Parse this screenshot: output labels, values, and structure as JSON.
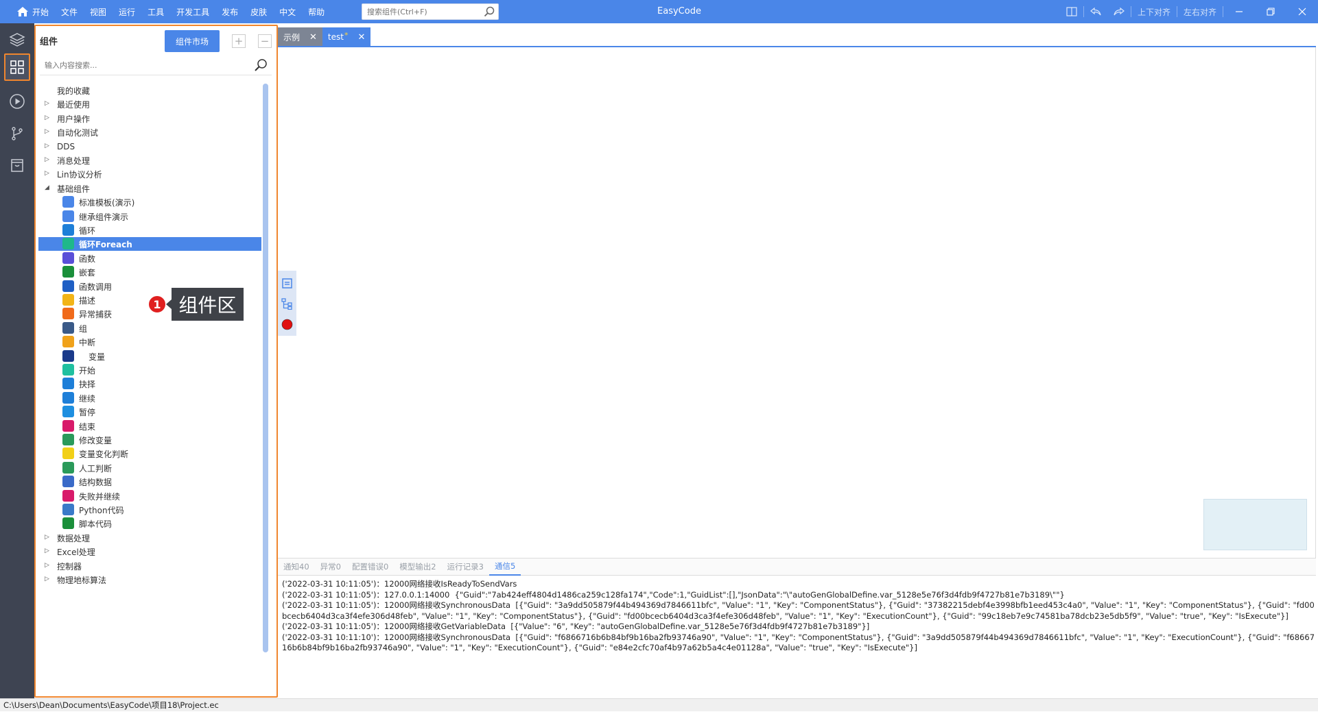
{
  "titlebar": {
    "app_title": "EasyCode",
    "menu": [
      "开始",
      "文件",
      "视图",
      "运行",
      "工具",
      "开发工具",
      "发布",
      "皮肤",
      "中文",
      "帮助"
    ],
    "search_placeholder": "搜索组件(Ctrl+F)",
    "align_vertical": "上下对齐",
    "align_horizontal": "左右对齐"
  },
  "panel": {
    "title": "组件",
    "market_button": "组件市场",
    "filter_placeholder": "输入内容搜索...",
    "tree": [
      {
        "label": "我的收藏",
        "level": 0,
        "caret": "none"
      },
      {
        "label": "最近使用",
        "level": 0,
        "caret": "collapsed"
      },
      {
        "label": "用户操作",
        "level": 0,
        "caret": "collapsed"
      },
      {
        "label": "自动化测试",
        "level": 0,
        "caret": "collapsed"
      },
      {
        "label": "DDS",
        "level": 0,
        "caret": "collapsed"
      },
      {
        "label": "消息处理",
        "level": 0,
        "caret": "collapsed"
      },
      {
        "label": "Lin协议分析",
        "level": 0,
        "caret": "collapsed"
      },
      {
        "label": "基础组件",
        "level": 0,
        "caret": "expanded"
      },
      {
        "label": "标准模板(演示)",
        "level": 1,
        "icon": "document-icon",
        "color": "#4a86e8"
      },
      {
        "label": "继承组件演示",
        "level": 1,
        "icon": "document-icon",
        "color": "#4a86e8"
      },
      {
        "label": "循环",
        "level": 1,
        "icon": "loop-icon",
        "color": "#1e7fd8"
      },
      {
        "label": "循环Foreach",
        "level": 1,
        "icon": "loop-foreach-icon",
        "color": "#1fb88a",
        "selected": true
      },
      {
        "label": "函数",
        "level": 1,
        "icon": "function-icon",
        "color": "#5a4fd8"
      },
      {
        "label": "嵌套",
        "level": 1,
        "icon": "nesting-icon",
        "color": "#1a8f3a"
      },
      {
        "label": "函数调用",
        "level": 1,
        "icon": "function-call-icon",
        "color": "#1f5fc4"
      },
      {
        "label": "描述",
        "level": 1,
        "icon": "description-icon",
        "color": "#f2b417"
      },
      {
        "label": "异常捕获",
        "level": 1,
        "icon": "bug-icon",
        "color": "#f06a1a"
      },
      {
        "label": "组",
        "level": 1,
        "icon": "group-icon",
        "color": "#3a5a88"
      },
      {
        "label": "中断",
        "level": 1,
        "icon": "break-icon",
        "color": "#f0a21a"
      },
      {
        "label": "变量",
        "level": 1,
        "icon": "variable-icon",
        "color": "#1a3a8a",
        "wide": true
      },
      {
        "label": "开始",
        "level": 1,
        "icon": "start-icon",
        "color": "#20c0a0"
      },
      {
        "label": "抉择",
        "level": 1,
        "icon": "choice-icon",
        "color": "#1e7fd8"
      },
      {
        "label": "继续",
        "level": 1,
        "icon": "continue-icon",
        "color": "#1e7fd8"
      },
      {
        "label": "暂停",
        "level": 1,
        "icon": "pause-icon",
        "color": "#1e8fe0"
      },
      {
        "label": "结束",
        "level": 1,
        "icon": "end-flag-icon",
        "color": "#d81a6a"
      },
      {
        "label": "修改变量",
        "level": 1,
        "icon": "modify-variable-icon",
        "color": "#2a9a5a"
      },
      {
        "label": "变量变化判断",
        "level": 1,
        "icon": "variable-change-icon",
        "color": "#f2d017"
      },
      {
        "label": "人工判断",
        "level": 1,
        "icon": "manual-judge-icon",
        "color": "#2a9a5a"
      },
      {
        "label": "结构数据",
        "level": 1,
        "icon": "struct-data-icon",
        "color": "#3a6ac8"
      },
      {
        "label": "失败并继续",
        "level": 1,
        "icon": "fail-continue-icon",
        "color": "#d81a6a"
      },
      {
        "label": "Python代码",
        "level": 1,
        "icon": "python-icon",
        "color": "#3a7ac8"
      },
      {
        "label": "脚本代码",
        "level": 1,
        "icon": "script-icon",
        "color": "#1a8f3a"
      },
      {
        "label": "数据处理",
        "level": 0,
        "caret": "collapsed"
      },
      {
        "label": "Excel处理",
        "level": 0,
        "caret": "collapsed"
      },
      {
        "label": "控制器",
        "level": 0,
        "caret": "collapsed"
      },
      {
        "label": "物理地标算法",
        "level": 0,
        "caret": "collapsed"
      }
    ]
  },
  "tabs": [
    {
      "label": "示例",
      "active": false
    },
    {
      "label": "test",
      "active": true,
      "modified": "*"
    }
  ],
  "callout": {
    "number": "1",
    "text": "组件区"
  },
  "log_tabs": [
    "通知40",
    "异常0",
    "配置错误0",
    "模型输出2",
    "运行记录3",
    "通信5"
  ],
  "log_active_tab": "通信5",
  "logs": [
    "('2022-03-31 10:11:05')：12000网络接收IsReadyToSendVars",
    "('2022-03-31 10:11:05')：127.0.0.1:14000  {\"Guid\":\"7ab424eff4804d1486ca259c128fa174\",\"Code\":1,\"GuidList\":[],\"JsonData\":\"\\\"autoGenGlobalDefine.var_5128e5e76f3d4fdb9f4727b81e7b3189\\\"\"}",
    "('2022-03-31 10:11:05')：12000网络接收SynchronousData  [{\"Guid\": \"3a9dd505879f44b494369d7846611bfc\", \"Value\": \"1\", \"Key\": \"ComponentStatus\"}, {\"Guid\": \"37382215debf4e3998bfb1eed453c4a0\", \"Value\": \"1\", \"Key\": \"ComponentStatus\"}, {\"Guid\": \"fd00bcecb6404d3ca3f4efe306d48feb\", \"Value\": \"1\", \"Key\": \"ComponentStatus\"}, {\"Guid\": \"fd00bcecb6404d3ca3f4efe306d48feb\", \"Value\": \"1\", \"Key\": \"ExecutionCount\"}, {\"Guid\": \"99c18eb7e9c74581ba78dcb23e5db5f9\", \"Value\": \"true\", \"Key\": \"IsExecute\"}]",
    "('2022-03-31 10:11:05')：12000网络接收GetVariableData  [{\"Value\": \"6\", \"Key\": \"autoGenGlobalDefine.var_5128e5e76f3d4fdb9f4727b81e7b3189\"}]",
    "('2022-03-31 10:11:10')：12000网络接收SynchronousData  [{\"Guid\": \"f6866716b6b84bf9b16ba2fb93746a90\", \"Value\": \"1\", \"Key\": \"ComponentStatus\"}, {\"Guid\": \"3a9dd505879f44b494369d7846611bfc\", \"Value\": \"1\", \"Key\": \"ExecutionCount\"}, {\"Guid\": \"f6866716b6b84bf9b16ba2fb93746a90\", \"Value\": \"1\", \"Key\": \"ExecutionCount\"}, {\"Guid\": \"e84e2cfc70af4b97a62b5a4c4e01128a\", \"Value\": \"true\", \"Key\": \"IsExecute\"}]"
  ],
  "statusbar": {
    "path": "C:\\Users\\Dean\\Documents\\EasyCode\\项目18\\Project.ec"
  },
  "colors": {
    "accent": "#4a86e8",
    "highlight_border": "#f0862e",
    "activity_bar": "#3e4452"
  }
}
